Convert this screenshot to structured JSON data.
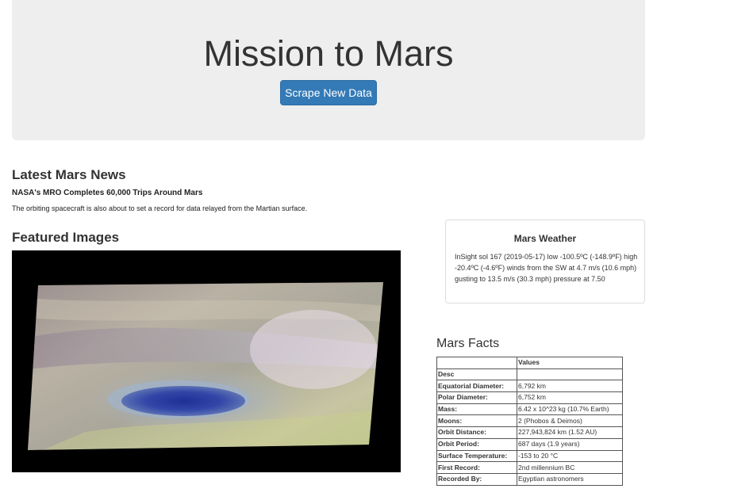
{
  "header": {
    "title": "Mission to Mars",
    "scrape_button_label": "Scrape New Data"
  },
  "news": {
    "heading": "Latest Mars News",
    "title": "NASA's MRO Completes 60,000 Trips Around Mars",
    "paragraph": "The orbiting spacecraft is also about to set a record for data relayed from the Martian surface."
  },
  "featured": {
    "heading": "Featured Images"
  },
  "weather": {
    "heading": "Mars Weather",
    "text": "InSight sol 167 (2019-05-17) low -100.5ºC (-148.9ºF) high -20.4ºC (-4.6ºF) winds from the SW at 4.7 m/s (10.6 mph) gusting to 13.5 m/s (30.3 mph) pressure at 7.50"
  },
  "facts": {
    "heading": "Mars Facts",
    "columns": [
      "",
      "Values"
    ],
    "index_label": "Desc",
    "rows": [
      {
        "label": "Equatorial Diameter:",
        "value": "6,792 km"
      },
      {
        "label": "Polar Diameter:",
        "value": "6,752 km"
      },
      {
        "label": "Mass:",
        "value": "6.42 x 10^23 kg (10.7% Earth)"
      },
      {
        "label": "Moons:",
        "value": "2 (Phobos & Deimos)"
      },
      {
        "label": "Orbit Distance:",
        "value": "227,943,824 km (1.52 AU)"
      },
      {
        "label": "Orbit Period:",
        "value": "687 days (1.9 years)"
      },
      {
        "label": "Surface Temperature:",
        "value": "-153 to 20 °C"
      },
      {
        "label": "First Record:",
        "value": "2nd millennium BC"
      },
      {
        "label": "Recorded By:",
        "value": "Egyptian astronomers"
      }
    ]
  },
  "colors": {
    "jumbotron_bg": "#eeeeee",
    "button_primary": "#337ab7",
    "image_bg": "#000000"
  }
}
